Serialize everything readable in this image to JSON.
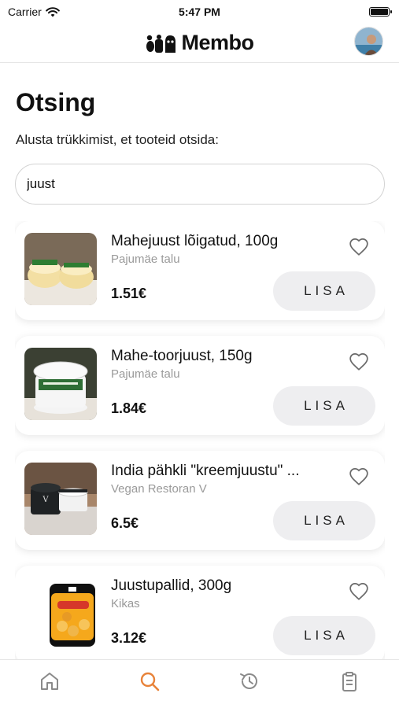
{
  "status_bar": {
    "carrier": "Carrier",
    "time": "5:47 PM",
    "battery_level": 1.0,
    "icons": [
      "wifi-icon",
      "battery-icon"
    ]
  },
  "header": {
    "brand": "Membo",
    "logo_icon": "membo-logo",
    "avatar_icon": "user-avatar"
  },
  "page": {
    "title": "Otsing",
    "subtitle": "Alusta trükkimist, et tooteid otsida:"
  },
  "search": {
    "value": "juust",
    "placeholder": ""
  },
  "products": [
    {
      "name": "Mahejuust lõigatud, 100g",
      "seller": "Pajumäe talu",
      "price": "1.51€",
      "button_label": "LISA",
      "favorite_icon": "heart-outline-icon"
    },
    {
      "name": "Mahe-toorjuust, 150g",
      "seller": "Pajumäe talu",
      "price": "1.84€",
      "button_label": "LISA",
      "favorite_icon": "heart-outline-icon"
    },
    {
      "name": "India pähkli \"kreemjuustu\" ...",
      "seller": "Vegan Restoran V",
      "price": "6.5€",
      "button_label": "LISA",
      "favorite_icon": "heart-outline-icon"
    },
    {
      "name": "Juustupallid, 300g",
      "seller": "Kikas",
      "price": "3.12€",
      "button_label": "LISA",
      "favorite_icon": "heart-outline-icon"
    }
  ],
  "tab_bar": {
    "tabs": [
      {
        "icon": "home-icon",
        "active": false
      },
      {
        "icon": "search-icon",
        "active": true
      },
      {
        "icon": "history-icon",
        "active": false
      },
      {
        "icon": "clipboard-icon",
        "active": false
      }
    ]
  },
  "colors": {
    "accent": "#e8833a",
    "inactive_icon": "#8a8a8a",
    "button_bg": "#eeeef0",
    "seller_text": "#9a9a9a"
  }
}
